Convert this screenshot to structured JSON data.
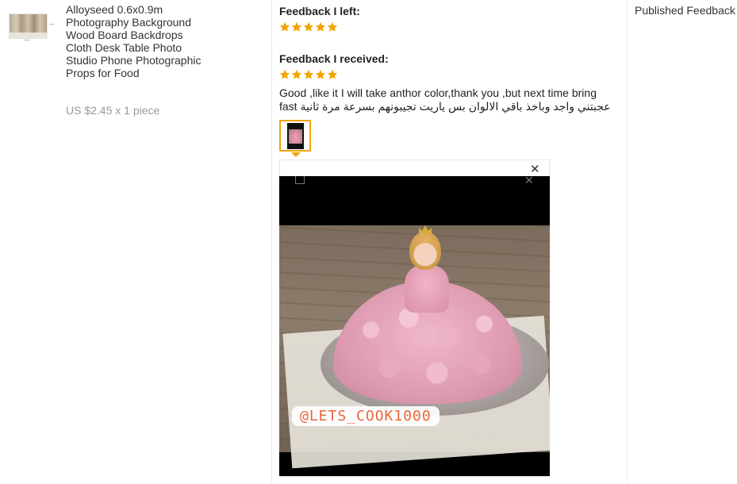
{
  "product": {
    "title": "Alloyseed 0.6x0.9m Photography Background Wood Board Backdrops Cloth Desk Table Photo Studio Phone Photographic Props for Food",
    "price": "US $2.45 x 1 piece"
  },
  "feedback_left": {
    "label": "Feedback I left:",
    "rating": 5
  },
  "feedback_received": {
    "label": "Feedback I received:",
    "rating": 5,
    "text_en": "Good ,like it I will take anthor color,thank you ,but next time bring fast",
    "text_ar": "عجبتني واجد وباخذ باقي الالوان بس ياريت تجيبونهم بسرعة مرة ثانية"
  },
  "photo_preview": {
    "watermark": "@LETS_COOK1000",
    "close_icon": "close-icon"
  },
  "colors": {
    "star": "#f0a500",
    "thumb_border": "#f0a500",
    "watermark": "#e8683a"
  },
  "published": {
    "label": "Published Feedback"
  }
}
